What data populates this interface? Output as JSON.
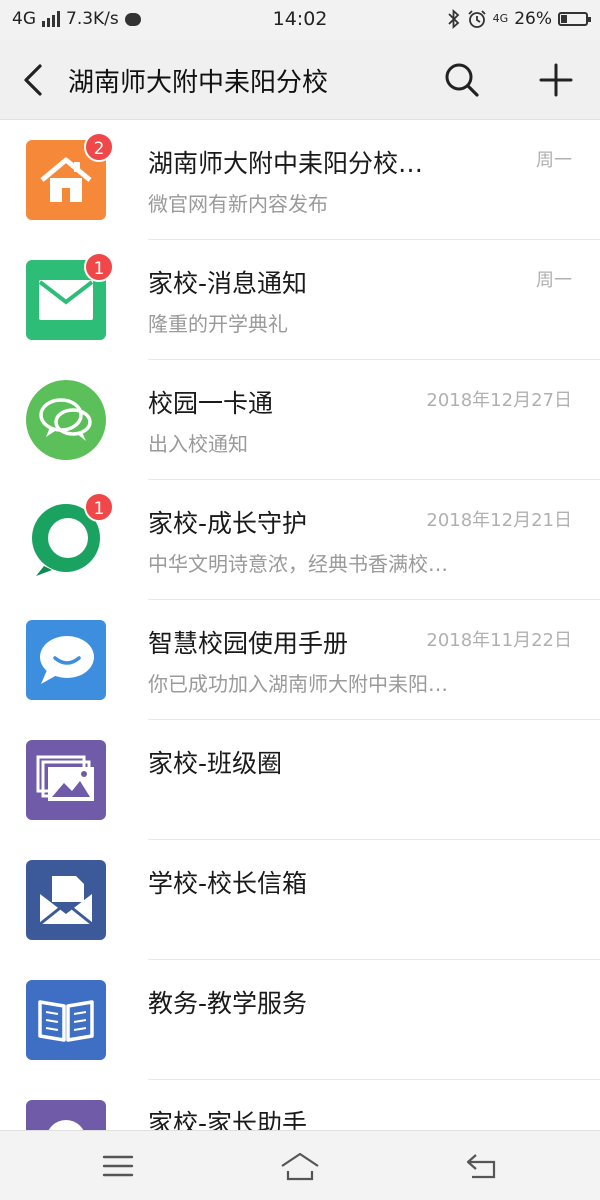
{
  "status_bar": {
    "network": "4G",
    "speed": "7.3K/s",
    "time": "14:02",
    "network_right": "4G",
    "battery": "26%",
    "battery_level": 0.26
  },
  "header": {
    "title": "湖南师大附中耒阳分校",
    "back_icon": "back-arrow-icon",
    "search_icon": "search-icon",
    "add_icon": "plus-icon"
  },
  "items": [
    {
      "name": "湖南师大附中耒阳分校…",
      "sub": "微官网有新内容发布",
      "time": "周一",
      "badge": "2",
      "icon": "house-icon",
      "color": "#f6883a"
    },
    {
      "name": "家校-消息通知",
      "sub": "隆重的开学典礼",
      "time": "周一",
      "badge": "1",
      "icon": "envelope-icon",
      "color": "#2ebd77"
    },
    {
      "name": "校园一卡通",
      "sub": "出入校通知",
      "time": "2018年12月27日",
      "badge": "",
      "icon": "chat-bubbles-icon",
      "color": "#5cc05a"
    },
    {
      "name": "家校-成长守护",
      "sub": "中华文明诗意浓，经典书香满校…",
      "time": "2018年12月21日",
      "badge": "1",
      "icon": "guard-circle-icon",
      "color": "#1aa260"
    },
    {
      "name": "智慧校园使用手册",
      "sub": "你已成功加入湖南师大附中耒阳…",
      "time": "2018年11月22日",
      "badge": "",
      "icon": "smile-bubble-icon",
      "color": "#3e8ee0"
    },
    {
      "name": "家校-班级圈",
      "sub": "",
      "time": "",
      "badge": "",
      "icon": "photo-album-icon",
      "color": "#6f5ba8"
    },
    {
      "name": "学校-校长信箱",
      "sub": "",
      "time": "",
      "badge": "",
      "icon": "mail-letter-icon",
      "color": "#3c5a9a"
    },
    {
      "name": "教务-教学服务",
      "sub": "",
      "time": "",
      "badge": "",
      "icon": "open-book-icon",
      "color": "#3f6fc4"
    },
    {
      "name": "家校-家长助手",
      "sub": "",
      "time": "",
      "badge": "",
      "icon": "assistant-icon",
      "color": "#6f5ba8"
    }
  ],
  "nav_bar": {
    "menu_icon": "menu-icon",
    "home_icon": "home-icon",
    "back_icon": "back-icon"
  }
}
